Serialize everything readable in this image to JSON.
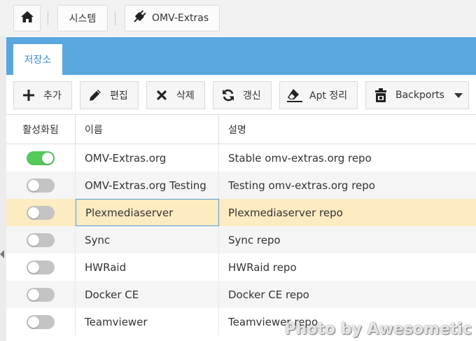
{
  "breadcrumb": {
    "home_icon": "home-icon",
    "system_label": "시스템",
    "plugin_icon": "plug-icon",
    "plugin_label": "OMV-Extras"
  },
  "tabs": [
    {
      "label": "저장소",
      "active": true
    }
  ],
  "toolbar": {
    "add_label": "추가",
    "edit_label": "편집",
    "delete_label": "삭제",
    "refresh_label": "갱신",
    "apt_clean_label": "Apt 정리",
    "backports_label": "Backports"
  },
  "grid": {
    "columns": [
      "활성화됨",
      "이름",
      "설명"
    ],
    "rows": [
      {
        "enabled": true,
        "name": "OMV-Extras.org",
        "description": "Stable omv-extras.org repo"
      },
      {
        "enabled": false,
        "name": "OMV-Extras.org Testing",
        "description": "Testing omv-extras.org repo"
      },
      {
        "enabled": false,
        "name": "Plexmediaserver",
        "description": "Plexmediaserver repo",
        "selected": true
      },
      {
        "enabled": false,
        "name": "Sync",
        "description": "Sync repo"
      },
      {
        "enabled": false,
        "name": "HWRaid",
        "description": "HWRaid repo"
      },
      {
        "enabled": false,
        "name": "Docker CE",
        "description": "Docker CE repo"
      },
      {
        "enabled": false,
        "name": "Teamviewer",
        "description": "Teamviewer repo"
      }
    ]
  },
  "colors": {
    "tab_bar": "#5aa7e0",
    "toggle_on": "#55c95a",
    "toggle_off": "#c4c4c4",
    "selected_row": "#fdebc2"
  },
  "watermark": "Photo by Awesometic"
}
